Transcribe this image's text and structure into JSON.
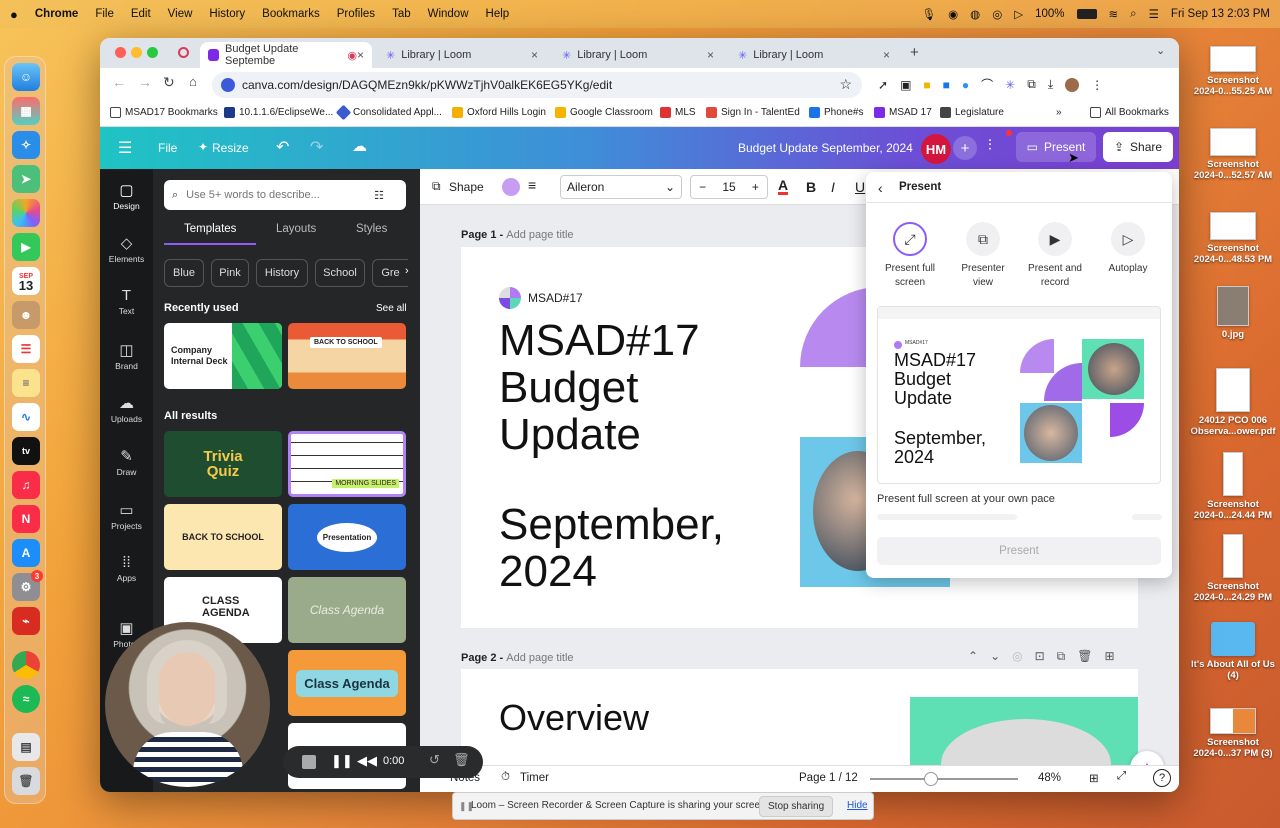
{
  "menubar": {
    "apple": "",
    "app": "Chrome",
    "items": [
      "File",
      "Edit",
      "View",
      "History",
      "Bookmarks",
      "Profiles",
      "Tab",
      "Window",
      "Help"
    ],
    "battery": "100%",
    "datetime": "Fri Sep 13  2:03 PM"
  },
  "dock": {
    "icons": [
      "finder-icon",
      "launchpad-icon",
      "safari-icon",
      "maps-icon",
      "photos-icon",
      "facetime-icon",
      "calendar-icon",
      "contacts-icon",
      "reminders-icon",
      "notes-icon",
      "freeform-icon",
      "appletv-icon",
      "music-icon",
      "news-icon",
      "appstore-icon",
      "settings-icon",
      "acrobat-icon",
      "chrome-icon",
      "spotify-icon",
      "preview-icon",
      "trash-icon"
    ],
    "calendar_month": "SEP",
    "calendar_day": "13",
    "settings_badge": "3"
  },
  "desktop": [
    {
      "l1": "Screenshot",
      "l2": "2024-0...55.25 AM"
    },
    {
      "l1": "Screenshot",
      "l2": "2024-0...52.57 AM"
    },
    {
      "l1": "Screenshot",
      "l2": "2024-0...48.53 PM"
    },
    {
      "l1": "0.jpg",
      "l2": ""
    },
    {
      "l1": "24012 PCO 006",
      "l2": "Observa...ower.pdf"
    },
    {
      "l1": "Screenshot",
      "l2": "2024-0...24.44 PM"
    },
    {
      "l1": "Screenshot",
      "l2": "2024-0...24.29 PM"
    },
    {
      "l1": "It's About All of Us",
      "l2": "(4)"
    },
    {
      "l1": "Screenshot",
      "l2": "2024-0...37 PM (3)"
    }
  ],
  "browser": {
    "tabs": [
      {
        "title": "Budget Update Septembe"
      },
      {
        "title": "Library | Loom"
      },
      {
        "title": "Library | Loom"
      },
      {
        "title": "Library | Loom"
      }
    ],
    "url": "canva.com/design/DAGQMEzn9kk/pKWWzTjhV0alkEK6EG5YKg/edit",
    "bookmarks": [
      "MSAD17 Bookmarks",
      "10.1.1.6/EclipseWe...",
      "Consolidated Appl...",
      "Oxford Hills Login",
      "Google Classroom",
      "MLS",
      "Sign In - TalentEd",
      "Phone#s",
      "MSAD 17",
      "Legislature"
    ],
    "all_bookmarks": "All Bookmarks"
  },
  "canva": {
    "header": {
      "file": "File",
      "resize": "Resize",
      "title": "Budget Update September, 2024",
      "avatar": "HM",
      "present": "Present",
      "share": "Share"
    },
    "rail": [
      "Design",
      "Elements",
      "Text",
      "Brand",
      "Uploads",
      "Draw",
      "Projects",
      "Apps",
      "Photos"
    ],
    "panel": {
      "search_placeholder": "Use 5+ words to describe...",
      "tabs": [
        "Templates",
        "Layouts",
        "Styles"
      ],
      "chips": [
        "Blue",
        "Pink",
        "History",
        "School",
        "Gre"
      ],
      "recently_used": "Recently used",
      "see_all": "See all",
      "all_results": "All results",
      "cards": [
        "Company Internal Deck",
        "BACK TO SCHOOL",
        "Trivia Quiz",
        "MORNING SLIDES",
        "BACK TO SCHOOL",
        "Presentation",
        "CLASS AGENDA",
        "Class Agenda",
        "Class Agenda"
      ]
    },
    "toolbar": {
      "shape": "Shape",
      "font": "Aileron",
      "size": "15",
      "minus": "−",
      "plus": "+"
    },
    "page1": {
      "label": "Page 1 - ",
      "add_title": "Add page title",
      "logo": "MSAD#17",
      "line1": "MSAD#17",
      "line2": "Budget",
      "line3": "Update",
      "line4": "September,",
      "line5": "2024"
    },
    "page2": {
      "label": "Page 2 - ",
      "add_title": "Add page title",
      "heading": "Overview"
    },
    "present_panel": {
      "title": "Present",
      "options": [
        {
          "l1": "Present full",
          "l2": "screen"
        },
        {
          "l1": "Presenter",
          "l2": "view"
        },
        {
          "l1": "Present and",
          "l2": "record"
        },
        {
          "l1": "Autoplay",
          "l2": ""
        }
      ],
      "preview_logo": "MSAD#17",
      "preview": [
        "MSAD#17",
        "Budget",
        "Update",
        "September,",
        "2024"
      ],
      "description": "Present full screen at your own pace",
      "button": "Present"
    },
    "bottom": {
      "notes": "Notes",
      "timer": "Timer",
      "page": "Page 1 / 12",
      "zoom": "48%",
      "help": "?"
    }
  },
  "recorder": {
    "time": "0:00"
  },
  "loom_bar": {
    "message": "Loom – Screen Recorder & Screen Capture is sharing your screen.",
    "stop": "Stop sharing",
    "hide": "Hide"
  }
}
